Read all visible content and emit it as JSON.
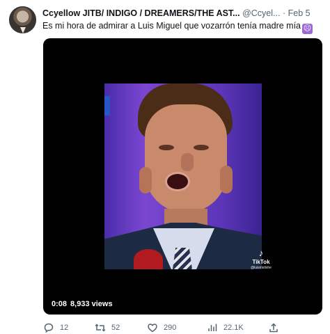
{
  "tweet": {
    "author": {
      "name": "Ccyellow JITB/ INDIGO / DREAMERS/THE AST...",
      "handle": "@Ccyel...",
      "separator": "·",
      "date": "Feb 5"
    },
    "text": "Es mi hora de admirar a Luis Miguel que vozarrón tenía madre mía",
    "emoji_icon": "crying-face-emoji",
    "media": {
      "watermark_label": "TikTok",
      "watermark_user": "@luismidishe",
      "duration": "0:08",
      "views": "8,933 views"
    },
    "actions": {
      "reply_count": "12",
      "retweet_count": "52",
      "like_count": "290",
      "view_count": "22.1K"
    },
    "colors": {
      "text": "#0f1419",
      "muted": "#536471",
      "media_bg": "#000000"
    }
  }
}
